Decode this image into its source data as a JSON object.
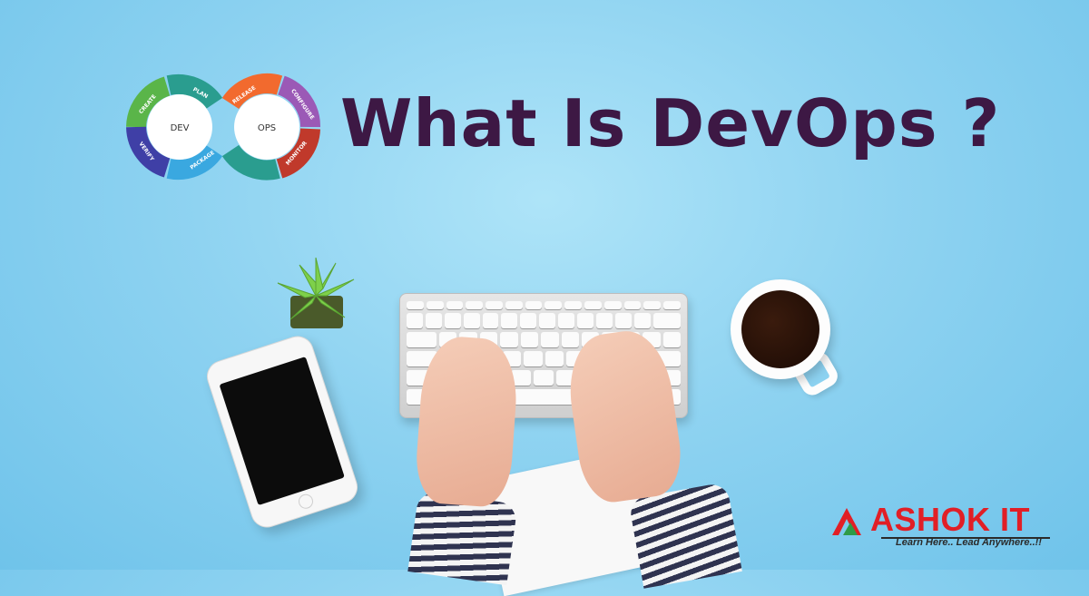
{
  "title": "What Is DevOps ?",
  "diagram": {
    "left_center": "DEV",
    "right_center": "OPS",
    "stages": [
      "CREATE",
      "PLAN",
      "RELEASE",
      "CONFIGURE",
      "MONITOR",
      "PACKAGE",
      "VERIFY"
    ],
    "colors": {
      "create": "#5ab549",
      "plan": "#2a9d8f",
      "release": "#f26a2e",
      "configure": "#9b59b6",
      "monitor": "#c0392b",
      "package": "#3aa8e0",
      "verify": "#3f3fa6"
    }
  },
  "logo": {
    "name": "ASHOK IT",
    "tagline": "Learn Here.. Lead Anywhere..!!",
    "color": "#e11f26"
  },
  "colors": {
    "title": "#3d1844",
    "background": "#8fd3f1"
  }
}
